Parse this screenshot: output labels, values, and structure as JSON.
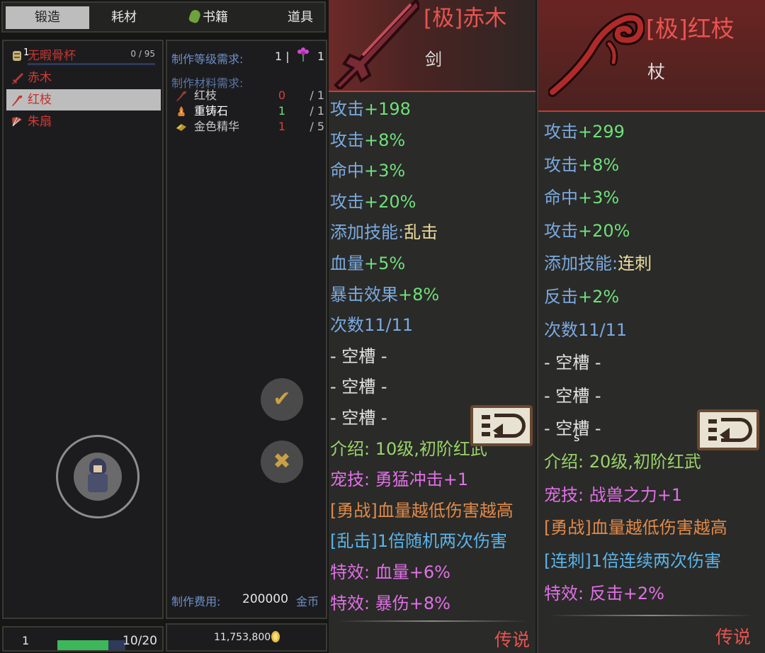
{
  "tabs": [
    {
      "label": "锻造",
      "active": true
    },
    {
      "label": "耗材",
      "active": false
    },
    {
      "label": "书籍",
      "active": false
    },
    {
      "label": "道具",
      "active": false
    }
  ],
  "list": {
    "items": [
      {
        "name": "无暇骨杯",
        "icon": "cup-icon",
        "badge": "1",
        "progress": "0 / 95"
      },
      {
        "name": "赤木",
        "icon": "sword-icon"
      },
      {
        "name": "红枝",
        "icon": "staff-icon",
        "selected": true
      },
      {
        "name": "朱扇",
        "icon": "fan-icon"
      }
    ]
  },
  "detail": {
    "level_req_label": "制作等级需求:",
    "level_req_value": "1 |",
    "flower_count": "1",
    "materials_label": "制作材料需求:",
    "materials": [
      {
        "name": "红枝",
        "have": "0",
        "need": "/ 1",
        "have_color": "#d6403a",
        "name_color": "#c8c8c8"
      },
      {
        "name": "重铸石",
        "have": "1",
        "need": "/ 1",
        "have_color": "#6ee07a",
        "name_color": "#ffffff"
      },
      {
        "name": "金色精华",
        "have": "1",
        "need": "/ 5",
        "have_color": "#d6403a",
        "name_color": "#c8c8c8"
      }
    ],
    "cost_label": "制作费用:",
    "cost_value": "200000",
    "cost_unit": "金币",
    "confirm_glyph": "✔",
    "cancel_glyph": "✖"
  },
  "bottom": {
    "level": "1",
    "exp": "10/20",
    "exp_fraction": 0.75,
    "gold": "11,753,800"
  },
  "card1": {
    "title": "[极]赤木",
    "type": "剑",
    "stats": [
      {
        "prefix": "攻击",
        "value": "+198",
        "pc": "c-blue",
        "vc": "c-green"
      },
      {
        "prefix": "攻击",
        "value": "+8%",
        "pc": "c-blue",
        "vc": "c-green"
      },
      {
        "prefix": "命中",
        "value": "+3%",
        "pc": "c-blue",
        "vc": "c-green"
      },
      {
        "prefix": "攻击",
        "value": "+20%",
        "pc": "c-blue",
        "vc": "c-green"
      },
      {
        "prefix": "添加技能:",
        "value": "乱击",
        "pc": "c-blue",
        "vc": "c-cream"
      },
      {
        "prefix": "血量",
        "value": "+5%",
        "pc": "c-blue",
        "vc": "c-green"
      },
      {
        "prefix": "暴击效果",
        "value": "+8%",
        "pc": "c-blue",
        "vc": "c-green"
      },
      {
        "prefix": "次数",
        "value": "11/11",
        "pc": "c-blue",
        "vc": "c-blue"
      },
      {
        "prefix": " - 空槽 -",
        "value": "",
        "pc": "c-white",
        "vc": "c-white"
      },
      {
        "prefix": " - 空槽 -",
        "value": "",
        "pc": "c-white",
        "vc": "c-white"
      },
      {
        "prefix": " - 空槽 -",
        "value": "",
        "pc": "c-white",
        "vc": "c-white"
      },
      {
        "prefix": "介绍:",
        "value": " 10级,初阶红武",
        "pc": "c-olive",
        "vc": "c-olive"
      },
      {
        "prefix": "宠技:",
        "value": " 勇猛冲击+1",
        "pc": "c-pink",
        "vc": "c-pink"
      },
      {
        "prefix": "[勇战]",
        "value": "血量越低伤害越高",
        "pc": "c-orange",
        "vc": "c-orange"
      },
      {
        "prefix": "[乱击]",
        "value": "1倍随机两次伤害",
        "pc": "c-sky",
        "vc": "c-sky"
      },
      {
        "prefix": "特效:",
        "value": " 血量+6%",
        "pc": "c-pink",
        "vc": "c-pink"
      },
      {
        "prefix": "特效:",
        "value": " 暴伤+8%",
        "pc": "c-pink",
        "vc": "c-pink"
      }
    ],
    "rarity": "传说"
  },
  "card2": {
    "title": "[极]红枝",
    "type": "杖",
    "stats": [
      {
        "prefix": "攻击",
        "value": "+299",
        "pc": "c-blue",
        "vc": "c-green"
      },
      {
        "prefix": "攻击",
        "value": "+8%",
        "pc": "c-blue",
        "vc": "c-green"
      },
      {
        "prefix": "命中",
        "value": "+3%",
        "pc": "c-blue",
        "vc": "c-green"
      },
      {
        "prefix": "攻击",
        "value": "+20%",
        "pc": "c-blue",
        "vc": "c-green"
      },
      {
        "prefix": "添加技能:",
        "value": "连刺",
        "pc": "c-blue",
        "vc": "c-cream"
      },
      {
        "prefix": "反击",
        "value": "+2%",
        "pc": "c-blue",
        "vc": "c-green"
      },
      {
        "prefix": "次数",
        "value": "11/11",
        "pc": "c-blue",
        "vc": "c-blue"
      },
      {
        "prefix": " - 空槽 -",
        "value": "",
        "pc": "c-white",
        "vc": "c-white"
      },
      {
        "prefix": " - 空槽 -",
        "value": "",
        "pc": "c-white",
        "vc": "c-white"
      },
      {
        "prefix": " - 空槽 -",
        "value": "",
        "pc": "c-white",
        "vc": "c-white"
      },
      {
        "prefix": "介绍:",
        "value": " 20级,初阶红武",
        "pc": "c-olive",
        "vc": "c-olive"
      },
      {
        "prefix": "宠技:",
        "value": " 战兽之力+1",
        "pc": "c-pink",
        "vc": "c-pink"
      },
      {
        "prefix": "[勇战]",
        "value": "血量越低伤害越高",
        "pc": "c-orange",
        "vc": "c-orange"
      },
      {
        "prefix": "[连刺]",
        "value": "1倍连续两次伤害",
        "pc": "c-sky",
        "vc": "c-sky"
      },
      {
        "prefix": "特效:",
        "value": " 反击+2%",
        "pc": "c-pink",
        "vc": "c-pink"
      }
    ],
    "rarity": "传说",
    "cursor_char": "s"
  }
}
